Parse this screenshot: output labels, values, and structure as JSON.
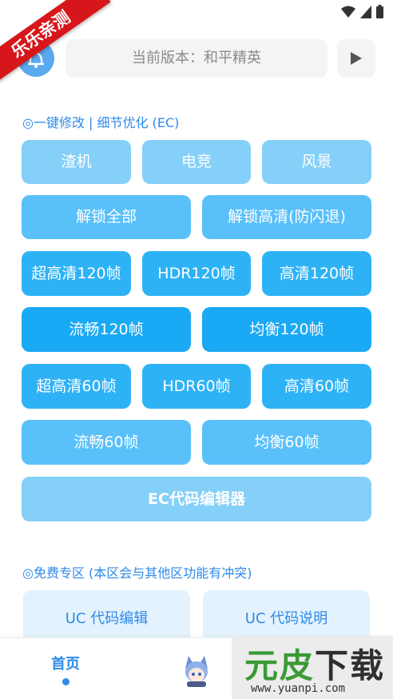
{
  "ribbon": {
    "label": "乐乐亲测"
  },
  "header": {
    "version_text": "当前版本：和平精英"
  },
  "section_ec": {
    "title": "◎一键修改 | 细节优化 (EC)",
    "row1": [
      "渣机",
      "电竞",
      "风景"
    ],
    "row2": [
      "解锁全部",
      "解锁高清(防闪退)"
    ],
    "row3": [
      "超高清120帧",
      "HDR120帧",
      "高清120帧"
    ],
    "row4": [
      "流畅120帧",
      "均衡120帧"
    ],
    "row5": [
      "超高清60帧",
      "HDR60帧",
      "高清60帧"
    ],
    "row6": [
      "流畅60帧",
      "均衡60帧"
    ],
    "editor": "EC代码编辑器"
  },
  "section_free": {
    "title": "◎免费专区 (本区会与其他区功能有冲突)",
    "cards": [
      "UC 代码编辑",
      "UC 代码说明"
    ]
  },
  "bottom_nav": {
    "home": "首页"
  },
  "watermark": {
    "big_part1": "元皮",
    "big_part2": "下载",
    "url": "www.yuanpi.com"
  },
  "colors": {
    "accent": "#2f8ae8",
    "ribbon": "#d7161b",
    "btn_light": "#85d0f8",
    "btn_deep": "#1aa9f4"
  }
}
